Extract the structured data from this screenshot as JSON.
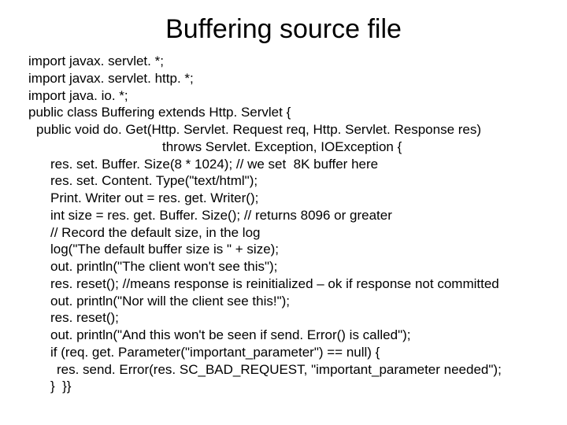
{
  "title": "Buffering source file",
  "lines": [
    {
      "cls": "",
      "text": "import javax. servlet. *;"
    },
    {
      "cls": "",
      "text": "import javax. servlet. http. *;"
    },
    {
      "cls": "",
      "text": "import java. io. *;"
    },
    {
      "cls": "",
      "text": "public class Buffering extends Http. Servlet {"
    },
    {
      "cls": "i1",
      "text": "public void do. Get(Http. Servlet. Request req, Http. Servlet. Response res)"
    },
    {
      "cls": "i4",
      "text": "throws Servlet. Exception, IOException {"
    },
    {
      "cls": "i2",
      "text": "res. set. Buffer. Size(8 * 1024); // we set  8K buffer here"
    },
    {
      "cls": "i2",
      "text": "res. set. Content. Type(\"text/html\");"
    },
    {
      "cls": "i2",
      "text": "Print. Writer out = res. get. Writer();"
    },
    {
      "cls": "i2",
      "text": "int size = res. get. Buffer. Size(); // returns 8096 or greater"
    },
    {
      "cls": "i2",
      "text": "// Record the default size, in the log"
    },
    {
      "cls": "i2",
      "text": "log(\"The default buffer size is \" + size);"
    },
    {
      "cls": "i2",
      "text": "out. println(\"The client won't see this\");"
    },
    {
      "cls": "i2",
      "text": "res. reset(); //means response is reinitialized – ok if response not committed"
    },
    {
      "cls": "i2",
      "text": "out. println(\"Nor will the client see this!\");"
    },
    {
      "cls": "i2",
      "text": "res. reset();"
    },
    {
      "cls": "i2",
      "text": "out. println(\"And this won't be seen if send. Error() is called\");"
    },
    {
      "cls": "i2",
      "text": "if (req. get. Parameter(\"important_parameter\") == null) {"
    },
    {
      "cls": "i3",
      "text": "res. send. Error(res. SC_BAD_REQUEST, \"important_parameter needed\");"
    },
    {
      "cls": "i2",
      "text": "}  }}"
    }
  ]
}
